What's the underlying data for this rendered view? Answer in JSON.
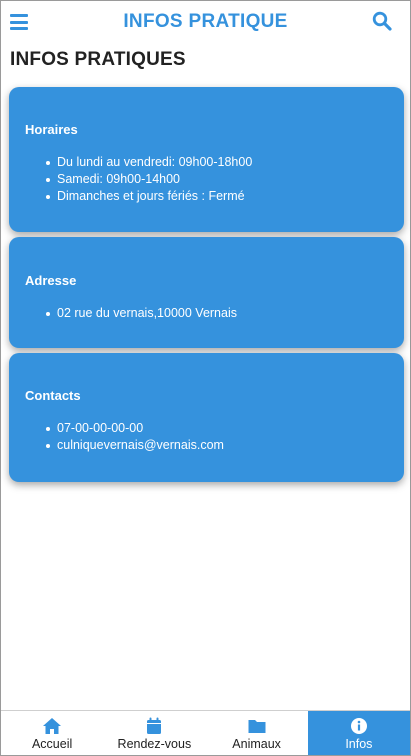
{
  "header": {
    "title": "INFOS PRATIQUE",
    "menu_icon": "hamburger-menu-icon",
    "search_icon": "search-icon"
  },
  "page_title": "INFOS PRATIQUES",
  "colors": {
    "accent": "#3592dd",
    "text": "#222222",
    "card_text": "#ffffff"
  },
  "cards": [
    {
      "title": "Horaires",
      "items": [
        "Du lundi au vendredi: 09h00-18h00",
        "Samedi: 09h00-14h00",
        "Dimanches et jours fériés : Fermé"
      ]
    },
    {
      "title": "Adresse",
      "items": [
        "02 rue du vernais,10000 Vernais"
      ]
    },
    {
      "title": "Contacts",
      "items": [
        "07-00-00-00-00",
        "culniquevernais@vernais.com"
      ]
    }
  ],
  "bottom_nav": [
    {
      "label": "Accueil",
      "icon": "home-icon",
      "active": false
    },
    {
      "label": "Rendez-vous",
      "icon": "calendar-icon",
      "active": false
    },
    {
      "label": "Animaux",
      "icon": "folder-icon",
      "active": false
    },
    {
      "label": "Infos",
      "icon": "info-icon",
      "active": true
    }
  ]
}
